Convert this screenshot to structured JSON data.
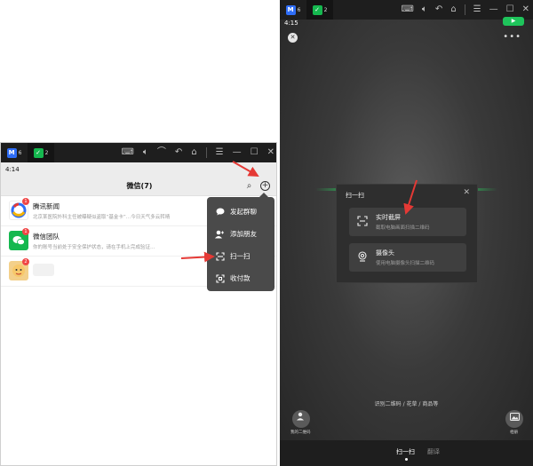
{
  "left_window": {
    "emu_tabs": [
      {
        "icon": "M",
        "count": "6"
      },
      {
        "icon": "✓",
        "count": "2"
      }
    ],
    "time": "4:14",
    "wechat_title": "微信(7)",
    "chats": [
      {
        "name": "腾讯新闻",
        "preview": "北京某医院外科主任被曝疑似盗取“基金卡”…今日天气多云转晴",
        "badge": "1",
        "avatar_color": "#ffffff"
      },
      {
        "name": "微信团队",
        "preview": "你的账号当前处于安全保护状态，请在手机上完成验证…",
        "badge": "1",
        "avatar_color": "#15b84f"
      },
      {
        "name": "",
        "preview": "",
        "badge": "2",
        "avatar_color": "#f0c06a"
      }
    ],
    "menu": {
      "items": [
        {
          "label": "发起群聊",
          "icon": "chat-bubble-icon"
        },
        {
          "label": "添加朋友",
          "icon": "add-friend-icon"
        },
        {
          "label": "扫一扫",
          "icon": "scan-icon"
        },
        {
          "label": "收付款",
          "icon": "payment-icon"
        }
      ]
    }
  },
  "right_window": {
    "time": "4:15",
    "scan_dialog": {
      "title": "扫一扫",
      "options": [
        {
          "title": "实时截屏",
          "desc": "截取电脑画面扫描二维码"
        },
        {
          "title": "摄像头",
          "desc": "使用电脑摄像头扫描二维码"
        }
      ]
    },
    "hint": "识别二维码 / 花草 / 商品等",
    "bottom_left_label": "我的二维码",
    "bottom_right_label": "相册",
    "bottom_tabs": [
      "扫一扫",
      "翻译"
    ]
  },
  "colors": {
    "accent_green": "#15b84f",
    "arrow_red": "#e53935",
    "menu_bg": "#4a4a4a"
  }
}
